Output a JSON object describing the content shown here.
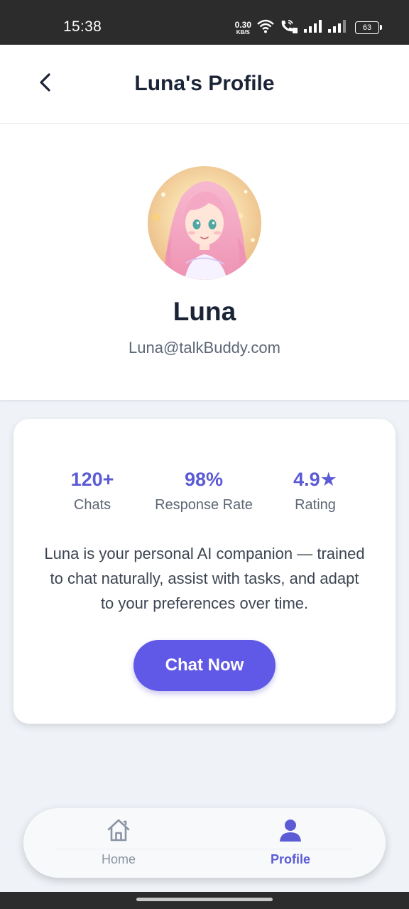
{
  "status_bar": {
    "time": "15:38",
    "net_speed_value": "0.30",
    "net_speed_unit": "KB/S",
    "battery": "63",
    "icons": [
      "wifi-icon",
      "wifi-call-icon",
      "signal-icon",
      "signal-icon",
      "battery-icon"
    ]
  },
  "header": {
    "back_icon": "chevron-left-icon",
    "title": "Luna's Profile"
  },
  "profile": {
    "name": "Luna",
    "email": "Luna@talkBuddy.com",
    "avatar": "anime-girl-avatar"
  },
  "stats": [
    {
      "value": "120+",
      "label": "Chats"
    },
    {
      "value": "98%",
      "label": "Response Rate"
    },
    {
      "value": "4.9★",
      "label": "Rating"
    }
  ],
  "description": "Luna is your personal AI companion — trained to chat naturally, assist with tasks, and adapt to your preferences over time.",
  "cta": {
    "label": "Chat Now"
  },
  "bottom_nav": {
    "items": [
      {
        "label": "Home",
        "icon": "home-icon",
        "active": false
      },
      {
        "label": "Profile",
        "icon": "user-icon",
        "active": true
      }
    ]
  },
  "colors": {
    "accent": "#5b5bd6",
    "button": "#6058e6",
    "background": "#eff3f8",
    "title_text": "#1b2437",
    "muted_text": "#5e6775"
  }
}
